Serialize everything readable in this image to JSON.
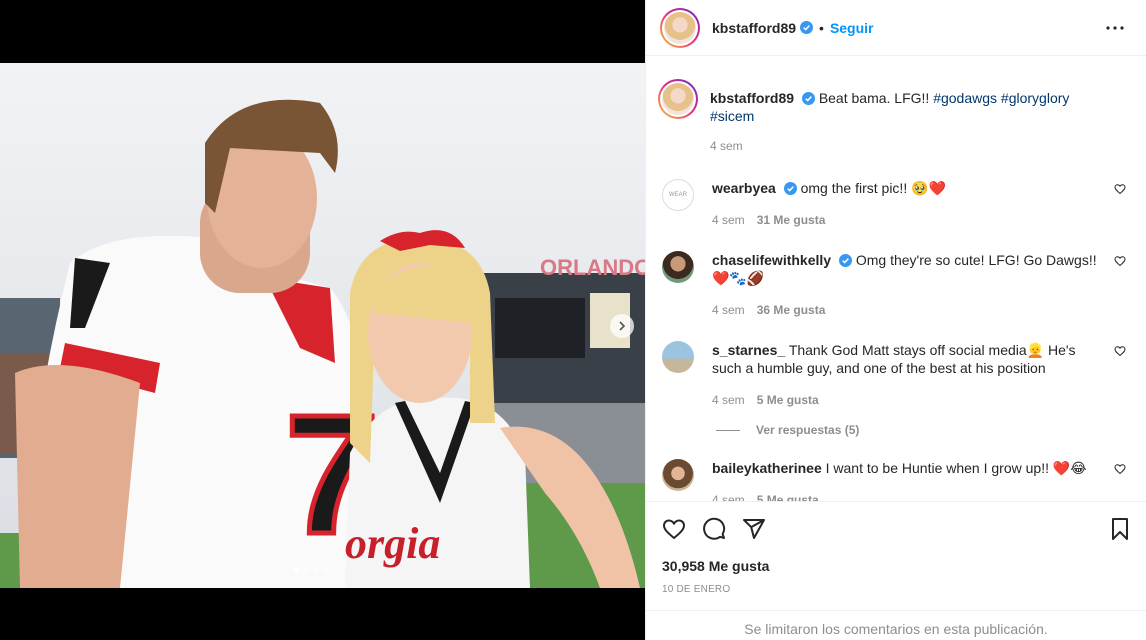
{
  "post": {
    "username": "kbstafford89",
    "follow_label": "Seguir",
    "separator": "•"
  },
  "caption": {
    "username": "kbstafford89",
    "text": "Beat bama. LFG!!",
    "hashtags": "#godawgs #gloryglory #sicem",
    "time": "4 sem"
  },
  "comments": [
    {
      "username": "wearbyea",
      "text": "omg the first pic!! 🥹❤️",
      "time": "4 sem",
      "likes": "31 Me gusta"
    },
    {
      "username": "chaselifewithkelly",
      "text": "Omg they're so cute! LFG! Go Dawgs!! ❤️🐾🏈",
      "time": "4 sem",
      "likes": "36 Me gusta"
    },
    {
      "username": "s_starnes_",
      "text": "Thank God Matt stays off social media👱 He's such a humble guy, and one of the best at his position",
      "time": "4 sem",
      "likes": "5 Me gusta"
    },
    {
      "username": "baileykatherinee",
      "text": "I want to be Huntie when I grow up!! ❤️😂",
      "time": "4 sem",
      "likes": "5 Me gusta"
    }
  ],
  "replies_label": "Ver respuestas (5)",
  "likes_count": "30,958 Me gusta",
  "date": "10 DE ENERO",
  "comments_limited": "Se limitaron los comentarios en esta publicación.",
  "media": {
    "slide_count": 4,
    "active_slide": 1
  },
  "colors": {
    "link_blue": "#0095f6",
    "hashtag": "#00376b",
    "muted": "#8e8e8e",
    "verified": "#3897f0"
  }
}
